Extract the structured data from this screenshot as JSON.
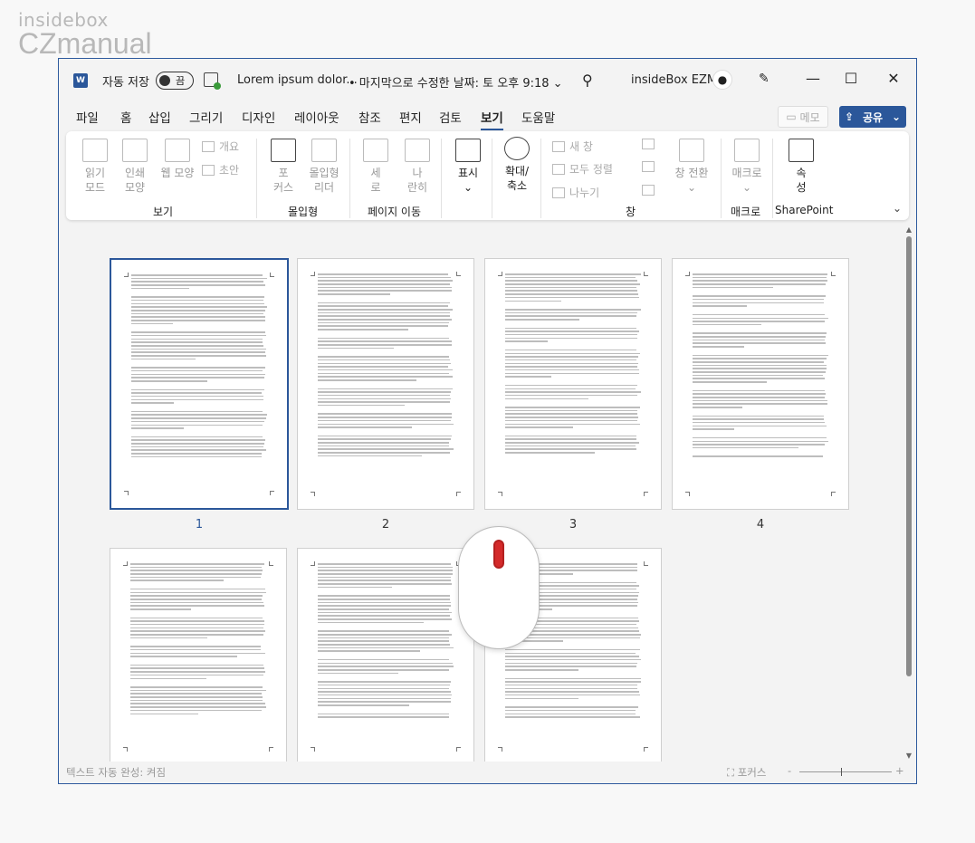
{
  "watermark": {
    "line1": "insidebox",
    "line2": "CZmanual"
  },
  "titlebar": {
    "app_icon": "W",
    "autosave_label": "자동 저장",
    "autosave_state": "끔",
    "doc_title": "Lorem ipsum dolor...",
    "modified_text": "•  마지막으로 수정한 날짜: 토 오후 9:18",
    "user_name": "insideBox EZM",
    "search_icon": "search-icon",
    "minimize": "—",
    "maximize": "☐",
    "close": "✕"
  },
  "menu": {
    "items": [
      "파일",
      "홈",
      "삽입",
      "그리기",
      "디자인",
      "레이아웃",
      "참조",
      "편지",
      "검토",
      "보기",
      "도움말"
    ],
    "active": "보기",
    "memo_label": "메모",
    "share_label": "공유"
  },
  "ribbon": {
    "groups": [
      "보기",
      "몰입형",
      "페이지 이동",
      "창",
      "매크로",
      "SharePoint"
    ],
    "read_mode": "읽기\n모드",
    "print_layout": "인쇄\n모양",
    "web_layout": "웹 모양",
    "outline": "개요",
    "draft": "초안",
    "focus": "포\n커스",
    "immersive_reader": "몰입형\n리더",
    "vertical": "세\n로",
    "side_by_side": "나\n란히",
    "show": "표시",
    "zoom": "확대/\n축소",
    "new_window": "새 창",
    "arrange_all": "모두 정렬",
    "split": "나누기",
    "switch_windows": "창 전환",
    "macros": "매크로",
    "properties": "속\n성"
  },
  "pages": [
    {
      "number": "1",
      "selected": true
    },
    {
      "number": "2",
      "selected": false
    },
    {
      "number": "3",
      "selected": false
    },
    {
      "number": "4",
      "selected": false
    },
    {
      "number": "",
      "selected": false
    },
    {
      "number": "",
      "selected": false
    },
    {
      "number": "",
      "selected": false
    }
  ],
  "statusbar": {
    "left": "텍스트 자동 완성: 켜짐",
    "focus": "포커스",
    "zoom_minus": "-",
    "zoom_plus": "+"
  }
}
